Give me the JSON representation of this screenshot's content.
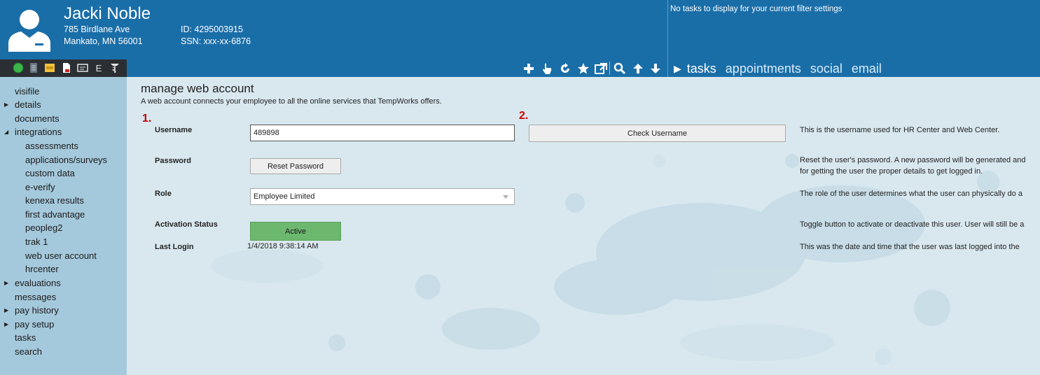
{
  "employee": {
    "name": "Jacki Noble",
    "address_line1": "785 Birdlane Ave",
    "address_line2": "Mankato, MN 56001",
    "id": "ID: 4295003915",
    "ssn": "SSN: xxx-xx-6876"
  },
  "status_strip": {
    "icons": [
      "status-green-icon",
      "document-icon",
      "dna-icon",
      "pdf-icon",
      "id-card-icon",
      "e-verify-icon",
      "caduceus-icon"
    ],
    "e_label": "E"
  },
  "toolbar": {
    "icons": [
      "add-icon",
      "hand-pointer-icon",
      "refresh-icon",
      "star-icon",
      "external-link-icon",
      "search-icon",
      "arrow-up-icon",
      "arrow-down-icon"
    ]
  },
  "tasks_panel": {
    "message": "No tasks to display for your current filter settings",
    "tabs": [
      "tasks",
      "appointments",
      "social",
      "email"
    ]
  },
  "sidebar": {
    "items": [
      {
        "label": "visifile",
        "arrow": ""
      },
      {
        "label": "details",
        "arrow": "right"
      },
      {
        "label": "documents",
        "arrow": ""
      },
      {
        "label": "integrations",
        "arrow": "down"
      },
      {
        "label": "assessments",
        "arrow": "",
        "sub": true
      },
      {
        "label": "applications/surveys",
        "arrow": "",
        "sub": true
      },
      {
        "label": "custom data",
        "arrow": "",
        "sub": true
      },
      {
        "label": "e-verify",
        "arrow": "",
        "sub": true
      },
      {
        "label": "kenexa results",
        "arrow": "",
        "sub": true
      },
      {
        "label": "first advantage",
        "arrow": "",
        "sub": true
      },
      {
        "label": "peopleg2",
        "arrow": "",
        "sub": true
      },
      {
        "label": "trak 1",
        "arrow": "",
        "sub": true
      },
      {
        "label": "web user account",
        "arrow": "",
        "sub": true
      },
      {
        "label": "hrcenter",
        "arrow": "",
        "sub": true
      },
      {
        "label": "evaluations",
        "arrow": "right"
      },
      {
        "label": "messages",
        "arrow": ""
      },
      {
        "label": "pay history",
        "arrow": "right"
      },
      {
        "label": "pay setup",
        "arrow": "right"
      },
      {
        "label": "tasks",
        "arrow": ""
      },
      {
        "label": "search",
        "arrow": ""
      }
    ]
  },
  "main": {
    "title": "manage web account",
    "subtitle": "A web account connects your employee to all the online services that TempWorks offers.",
    "step1": "1.",
    "step2": "2.",
    "username": {
      "label": "Username",
      "value": "489898",
      "check_button": "Check Username",
      "description": "This is the username used for HR Center and Web Center."
    },
    "password": {
      "label": "Password",
      "reset_button": "Reset Password",
      "description_line1": "Reset the user's password. A new password will be generated and",
      "description_line2": "for getting the user the proper details to get logged in."
    },
    "role": {
      "label": "Role",
      "value": "Employee Limited",
      "description": "The role of the user determines what the user can physically do a"
    },
    "activation": {
      "label": "Activation Status",
      "button": "Active",
      "description": "Toggle button to activate or deactivate this user. User will still be a"
    },
    "last_login": {
      "label": "Last Login",
      "value": "1/4/2018 9:38:14 AM",
      "description": "This was the date and time that the user was last logged into the"
    }
  },
  "colors": {
    "header_blue": "#1a6ea8",
    "sidebar_blue": "#a5c9dc",
    "main_bg": "#d9e8ef",
    "active_green": "#6db86f",
    "step_red": "#cc0000"
  }
}
